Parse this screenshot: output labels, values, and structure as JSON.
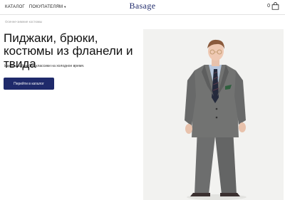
{
  "header": {
    "nav": [
      {
        "label": "КАТАЛОГ",
        "has_caret": false
      },
      {
        "label": "ПОКУПАТЕЛЯМ",
        "has_caret": true
      }
    ],
    "logo": "Basage",
    "cart_count": "0"
  },
  "breadcrumb": "Осенне-зимние костюмы",
  "hero": {
    "headline": "Пиджаки, брюки, костюмы из фланели и твида",
    "subtext": "Идеальный выбор классики на холодное время.",
    "cta_label": "Перейти в каталог"
  },
  "colors": {
    "brand": "#1f2a6b",
    "background": "#ffffff",
    "photo_background": "#f2f2f0"
  },
  "icons": [
    "chevron-down-icon",
    "shopping-bag-icon"
  ]
}
